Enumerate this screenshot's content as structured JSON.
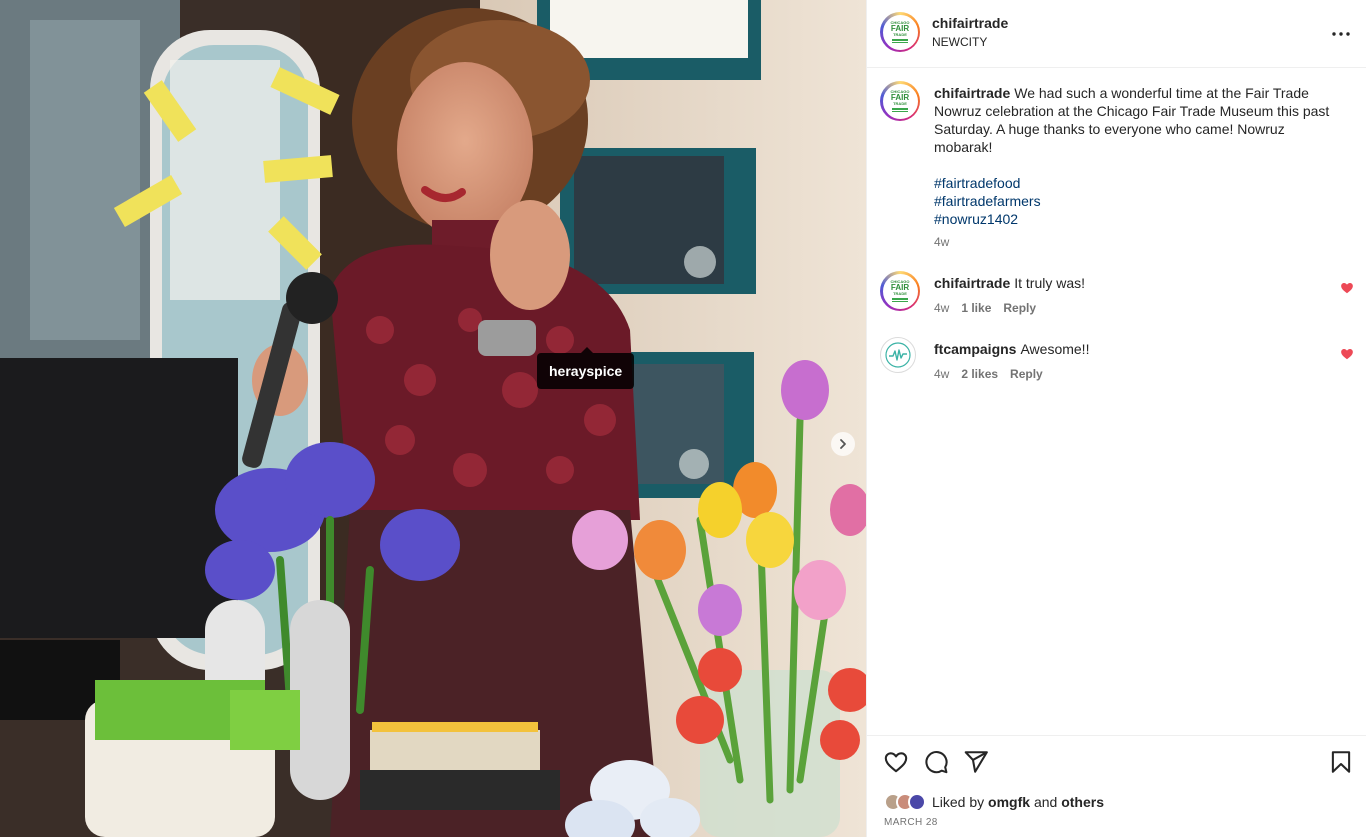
{
  "post": {
    "username": "chifairtrade",
    "location": "NEWCITY",
    "photo_tag": "herayspice",
    "caption": "We had such a wonderful time at the Fair Trade Nowruz celebration at the Chicago Fair Trade Museum this past Saturday. A huge thanks to everyone who came! Nowruz mobarak!",
    "hashtags": [
      "#fairtradefood",
      "#fairtradefarmers",
      "#nowruz1402"
    ],
    "caption_age": "4w",
    "avatar_text": {
      "line1": "CHICAGO",
      "line2": "FAIR",
      "line3": "TRADE"
    }
  },
  "comments": [
    {
      "username": "chifairtrade",
      "text": "It truly was!",
      "age": "4w",
      "likes": "1 like",
      "reply": "Reply",
      "liked": true
    },
    {
      "username": "ftcampaigns",
      "text": "Awesome!!",
      "age": "4w",
      "likes": "2 likes",
      "reply": "Reply",
      "liked": true
    }
  ],
  "footer": {
    "liked_by_prefix": "Liked by",
    "liked_by_user": "omgfk",
    "liked_by_and": "and",
    "liked_by_others": "others",
    "date": "MARCH 28"
  },
  "colors": {
    "heart": "#ed4956",
    "hashtag": "#00376b",
    "muted": "#737373",
    "text": "#262626"
  },
  "icons": [
    "more-icon",
    "next-arrow-icon",
    "heart-icon",
    "comment-icon",
    "share-icon",
    "bookmark-icon",
    "liked-heart-icon"
  ]
}
